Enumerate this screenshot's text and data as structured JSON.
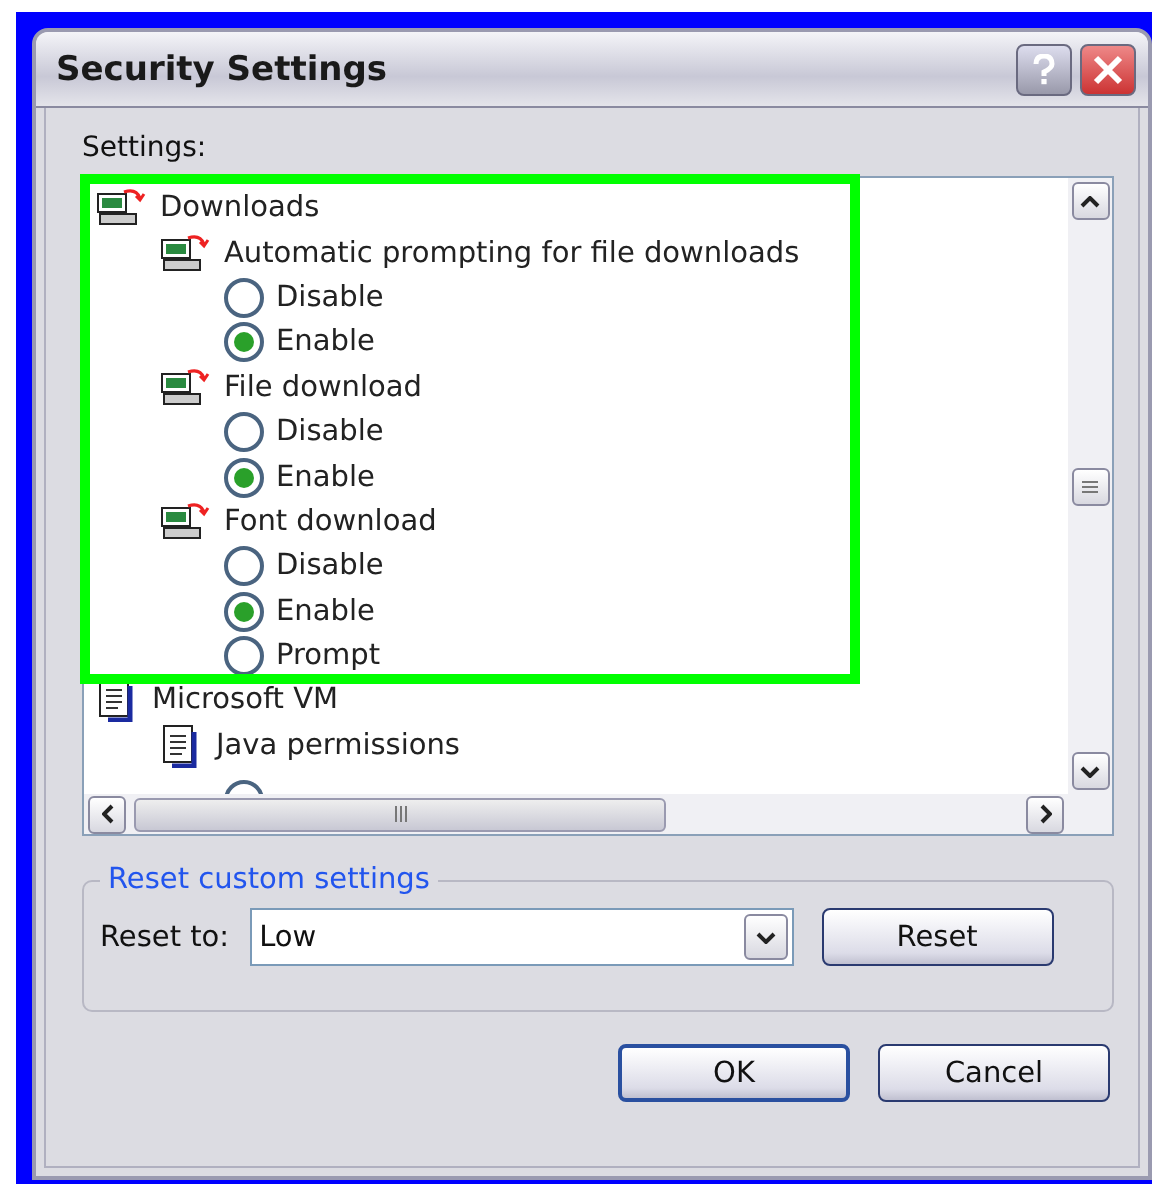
{
  "window": {
    "title": "Security Settings"
  },
  "settings_label": "Settings:",
  "tree": [
    {
      "kind": "group",
      "label": "Downloads",
      "children": [
        {
          "kind": "setting",
          "label": "Automatic prompting for file downloads",
          "children": [
            {
              "kind": "option",
              "label": "Disable",
              "selected": false
            },
            {
              "kind": "option",
              "label": "Enable",
              "selected": true
            }
          ]
        },
        {
          "kind": "setting",
          "label": "File download",
          "children": [
            {
              "kind": "option",
              "label": "Disable",
              "selected": false
            },
            {
              "kind": "option",
              "label": "Enable",
              "selected": true
            }
          ]
        },
        {
          "kind": "setting",
          "label": "Font download",
          "children": [
            {
              "kind": "option",
              "label": "Disable",
              "selected": false
            },
            {
              "kind": "option",
              "label": "Enable",
              "selected": true
            },
            {
              "kind": "option",
              "label": "Prompt",
              "selected": false
            }
          ]
        }
      ]
    },
    {
      "kind": "page",
      "label": "Microsoft VM",
      "children": [
        {
          "kind": "page",
          "label": "Java permissions"
        }
      ]
    }
  ],
  "reset_group": {
    "title": "Reset custom settings",
    "label": "Reset to:",
    "value": "Low",
    "button": "Reset"
  },
  "buttons": [
    "OK",
    "Cancel"
  ]
}
